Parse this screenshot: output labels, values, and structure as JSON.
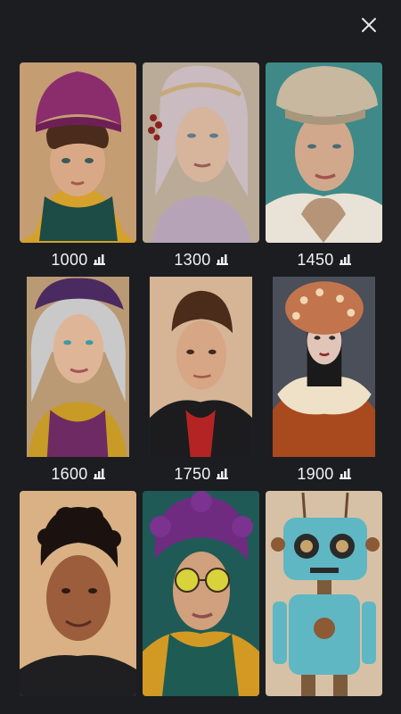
{
  "header": {
    "close_icon": "close-icon"
  },
  "gallery": {
    "items": [
      {
        "id": "kid-purple-beanie",
        "value": "1000",
        "icon": "bar-chart-icon"
      },
      {
        "id": "older-woman-veil",
        "value": "1300",
        "icon": "bar-chart-icon"
      },
      {
        "id": "man-flat-cap",
        "value": "1450",
        "icon": "bar-chart-icon"
      },
      {
        "id": "grey-hair-woman",
        "value": "1600",
        "icon": "bar-chart-icon"
      },
      {
        "id": "boy-black-coat",
        "value": "1750",
        "icon": "bar-chart-icon"
      },
      {
        "id": "woman-fur-hat",
        "value": "1900",
        "icon": "bar-chart-icon"
      },
      {
        "id": "curly-hair-boy",
        "value": "",
        "icon": ""
      },
      {
        "id": "purple-hair-glasses",
        "value": "",
        "icon": ""
      },
      {
        "id": "rusty-robot",
        "value": "",
        "icon": ""
      }
    ]
  },
  "colors": {
    "background": "#1b1d21",
    "text": "#f2f2f2"
  }
}
